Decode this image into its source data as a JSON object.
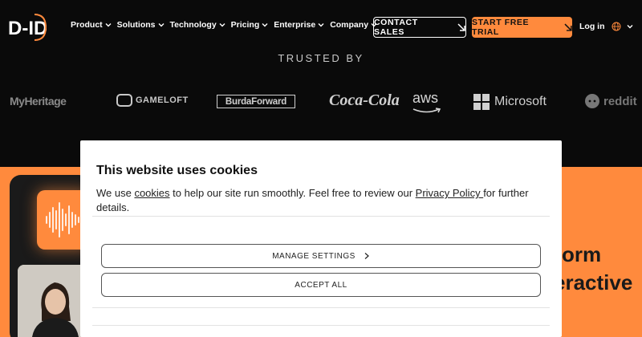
{
  "nav": {
    "logo_alt": "D-ID",
    "menu": [
      {
        "label": "Product",
        "name": "product"
      },
      {
        "label": "Solutions",
        "name": "solutions"
      },
      {
        "label": "Technology",
        "name": "technology"
      },
      {
        "label": "Pricing",
        "name": "pricing"
      },
      {
        "label": "Enterprise",
        "name": "enterprise"
      },
      {
        "label": "Company",
        "name": "company"
      }
    ],
    "contact_label": "CONTACT SALES",
    "trial_label": "START FREE TRIAL",
    "login_label": "Log in"
  },
  "trusted": {
    "heading": "TRUSTED BY",
    "logos": [
      "MyHeritage",
      "GAMELOFT",
      "BurdaForward",
      "Coca-Cola",
      "aws",
      "Microsoft",
      "reddit"
    ]
  },
  "hero": {
    "line1": "orm",
    "line2": "eractive"
  },
  "cookie": {
    "title": "This website uses cookies",
    "body_pre": "We use ",
    "link_cookies": "cookies",
    "body_mid": " to help our site run smoothly. Feel free to review our ",
    "link_privacy": "Privacy Policy ",
    "body_post": "for further details.",
    "manage_label": "MANAGE SETTINGS",
    "accept_label": "ACCEPT ALL"
  },
  "colors": {
    "accent": "#ff8a3d",
    "background": "#0a0a0a"
  }
}
